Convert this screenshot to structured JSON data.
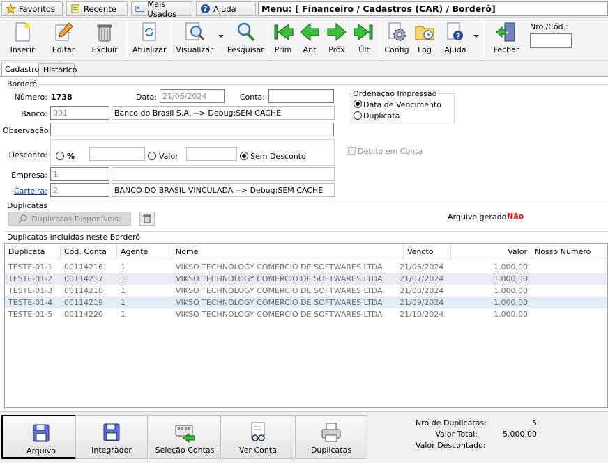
{
  "topbar": {
    "favoritos": "Favoritos",
    "recente": "Recente",
    "mais_usados": "Mais Usados",
    "ajuda": "Ajuda",
    "menu_path": "Menu: [ Financeiro / Cadastros (CAR) / Borderô]"
  },
  "toolbar": {
    "inserir": "Inserir",
    "editar": "Editar",
    "excluir": "Excluir",
    "atualizar": "Atualizar",
    "visualizar": "Visualizar",
    "pesquisar": "Pesquisar",
    "prim": "Prim",
    "ant": "Ant",
    "prox": "Próx",
    "ult": "Últ",
    "config": "Config",
    "log": "Log",
    "ajuda": "Ajuda",
    "fechar": "Fechar",
    "nro_cod_label": "Nro./Cód.:",
    "nro_cod_value": ""
  },
  "tabs": {
    "cadastro": "Cadastro",
    "historico": "Histórico"
  },
  "bordero": {
    "section_title": "Borderô",
    "numero_label": "Número:",
    "numero_value": "1738",
    "data_label": "Data:",
    "data_value": "21/06/2024",
    "conta_label": "Conta:",
    "conta_value": "",
    "banco_label": "Banco:",
    "banco_code": "001",
    "banco_name": "Banco do Brasil S.A.   --> Debug:SEM CACHE",
    "observacao_label": "Observação:",
    "observacao_value": "",
    "desconto_label": "Desconto:",
    "desconto_percent_label": "%",
    "desconto_percent_value": "",
    "desconto_valor_label": "Valor",
    "desconto_valor_value": "",
    "sem_desconto_label": "Sem Desconto",
    "empresa_label": "Empresa:",
    "empresa_code": "1",
    "empresa_name": "",
    "carteira_label": "Carteira:",
    "carteira_code": "2",
    "carteira_name": "BANCO DO BRASIL VINCULADA   --> Debug:SEM CACHE",
    "ordenacao_title": "Ordenação Impressão",
    "ordenacao_vencimento": "Data de Vencimento",
    "ordenacao_duplicata": "Duplicata",
    "debito_em_conta": "Débito em Conta"
  },
  "duplicatas": {
    "section_title": "Duplicatas",
    "disponiveis_button": "Duplicatas Disponíveis:",
    "arquivo_gerado_label": "Arquivo gerado:",
    "arquivo_gerado_value": "Não",
    "incluidas_title": "Duplicatas incluídas neste Borderô",
    "columns": [
      "Duplicata",
      "Cód. Conta",
      "Agente",
      "Nome",
      "Vencto",
      "Valor",
      "Nosso Numero"
    ],
    "rows": [
      [
        "TESTE-01-1",
        "00114216",
        "1",
        "VIKSO TECHNOLOGY COMERCIO DE SOFTWARES LTDA",
        "21/06/2024",
        "1.000,00",
        ""
      ],
      [
        "TESTE-01-2",
        "00114217",
        "1",
        "VIKSO TECHNOLOGY COMERCIO DE SOFTWARES LTDA",
        "21/07/2024",
        "1.000,00",
        ""
      ],
      [
        "TESTE-01-3",
        "00114218",
        "1",
        "VIKSO TECHNOLOGY COMERCIO DE SOFTWARES LTDA",
        "21/08/2024",
        "1.000,00",
        ""
      ],
      [
        "TESTE-01-4",
        "00114219",
        "1",
        "VIKSO TECHNOLOGY COMERCIO DE SOFTWARES LTDA",
        "21/09/2024",
        "1.000,00",
        ""
      ],
      [
        "TESTE-01-5",
        "00114220",
        "1",
        "VIKSO TECHNOLOGY COMERCIO DE SOFTWARES LTDA",
        "21/10/2024",
        "1.000,00",
        ""
      ]
    ]
  },
  "bottom": {
    "arquivo": "Arquivo",
    "integrador": "Integrador",
    "selecao_contas": "Seleção Contas",
    "ver_conta": "Ver Conta",
    "duplicatas": "Duplicatas",
    "nro_duplicatas_label": "Nro de Duplicatas:",
    "nro_duplicatas_value": "5",
    "valor_total_label": "Valor Total:",
    "valor_total_value": "5.000,00",
    "valor_descontado_label": "Valor Descontado:",
    "valor_descontado_value": ""
  },
  "colors": {
    "accent_red": "#d40000",
    "link_blue": "#0033cc",
    "nav_green": "#2ea02e"
  }
}
